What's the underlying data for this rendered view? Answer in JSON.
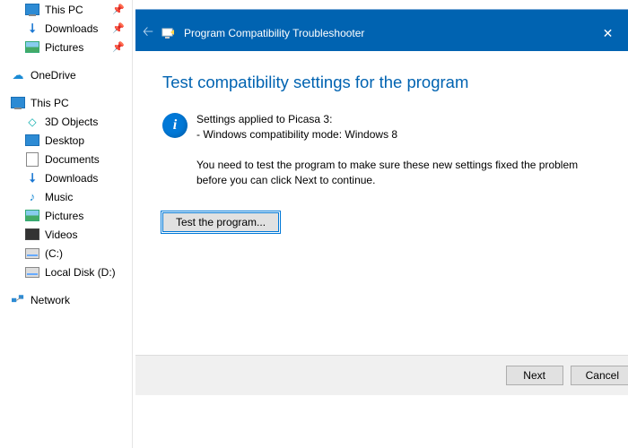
{
  "sidebar": {
    "quick": [
      {
        "label": "This PC",
        "icon": "monitor",
        "pinned": true
      },
      {
        "label": "Downloads",
        "icon": "down",
        "pinned": true
      },
      {
        "label": "Pictures",
        "icon": "pic",
        "pinned": true
      }
    ],
    "onedrive": {
      "label": "OneDrive",
      "icon": "cloud"
    },
    "thispc": {
      "label": "This PC",
      "children": [
        {
          "label": "3D Objects",
          "icon": "3d"
        },
        {
          "label": "Desktop",
          "icon": "folder-blue"
        },
        {
          "label": "Documents",
          "icon": "doc"
        },
        {
          "label": "Downloads",
          "icon": "down"
        },
        {
          "label": "Music",
          "icon": "music"
        },
        {
          "label": "Pictures",
          "icon": "pic"
        },
        {
          "label": "Videos",
          "icon": "video"
        },
        {
          "label": "(C:)",
          "icon": "drive"
        },
        {
          "label": "Local Disk (D:)",
          "icon": "drive"
        }
      ]
    },
    "network": {
      "label": "Network",
      "icon": "net"
    }
  },
  "dialog": {
    "header_title": "Program Compatibility Troubleshooter",
    "heading": "Test compatibility settings for the program",
    "info_line1": "Settings applied to Picasa 3:",
    "info_line2": "- Windows compatibility mode: Windows 8",
    "info_para": "You need to test the program to make sure these new settings fixed the problem before you can click Next to continue.",
    "test_button": "Test the program...",
    "next_button": "Next",
    "cancel_button": "Cancel"
  }
}
